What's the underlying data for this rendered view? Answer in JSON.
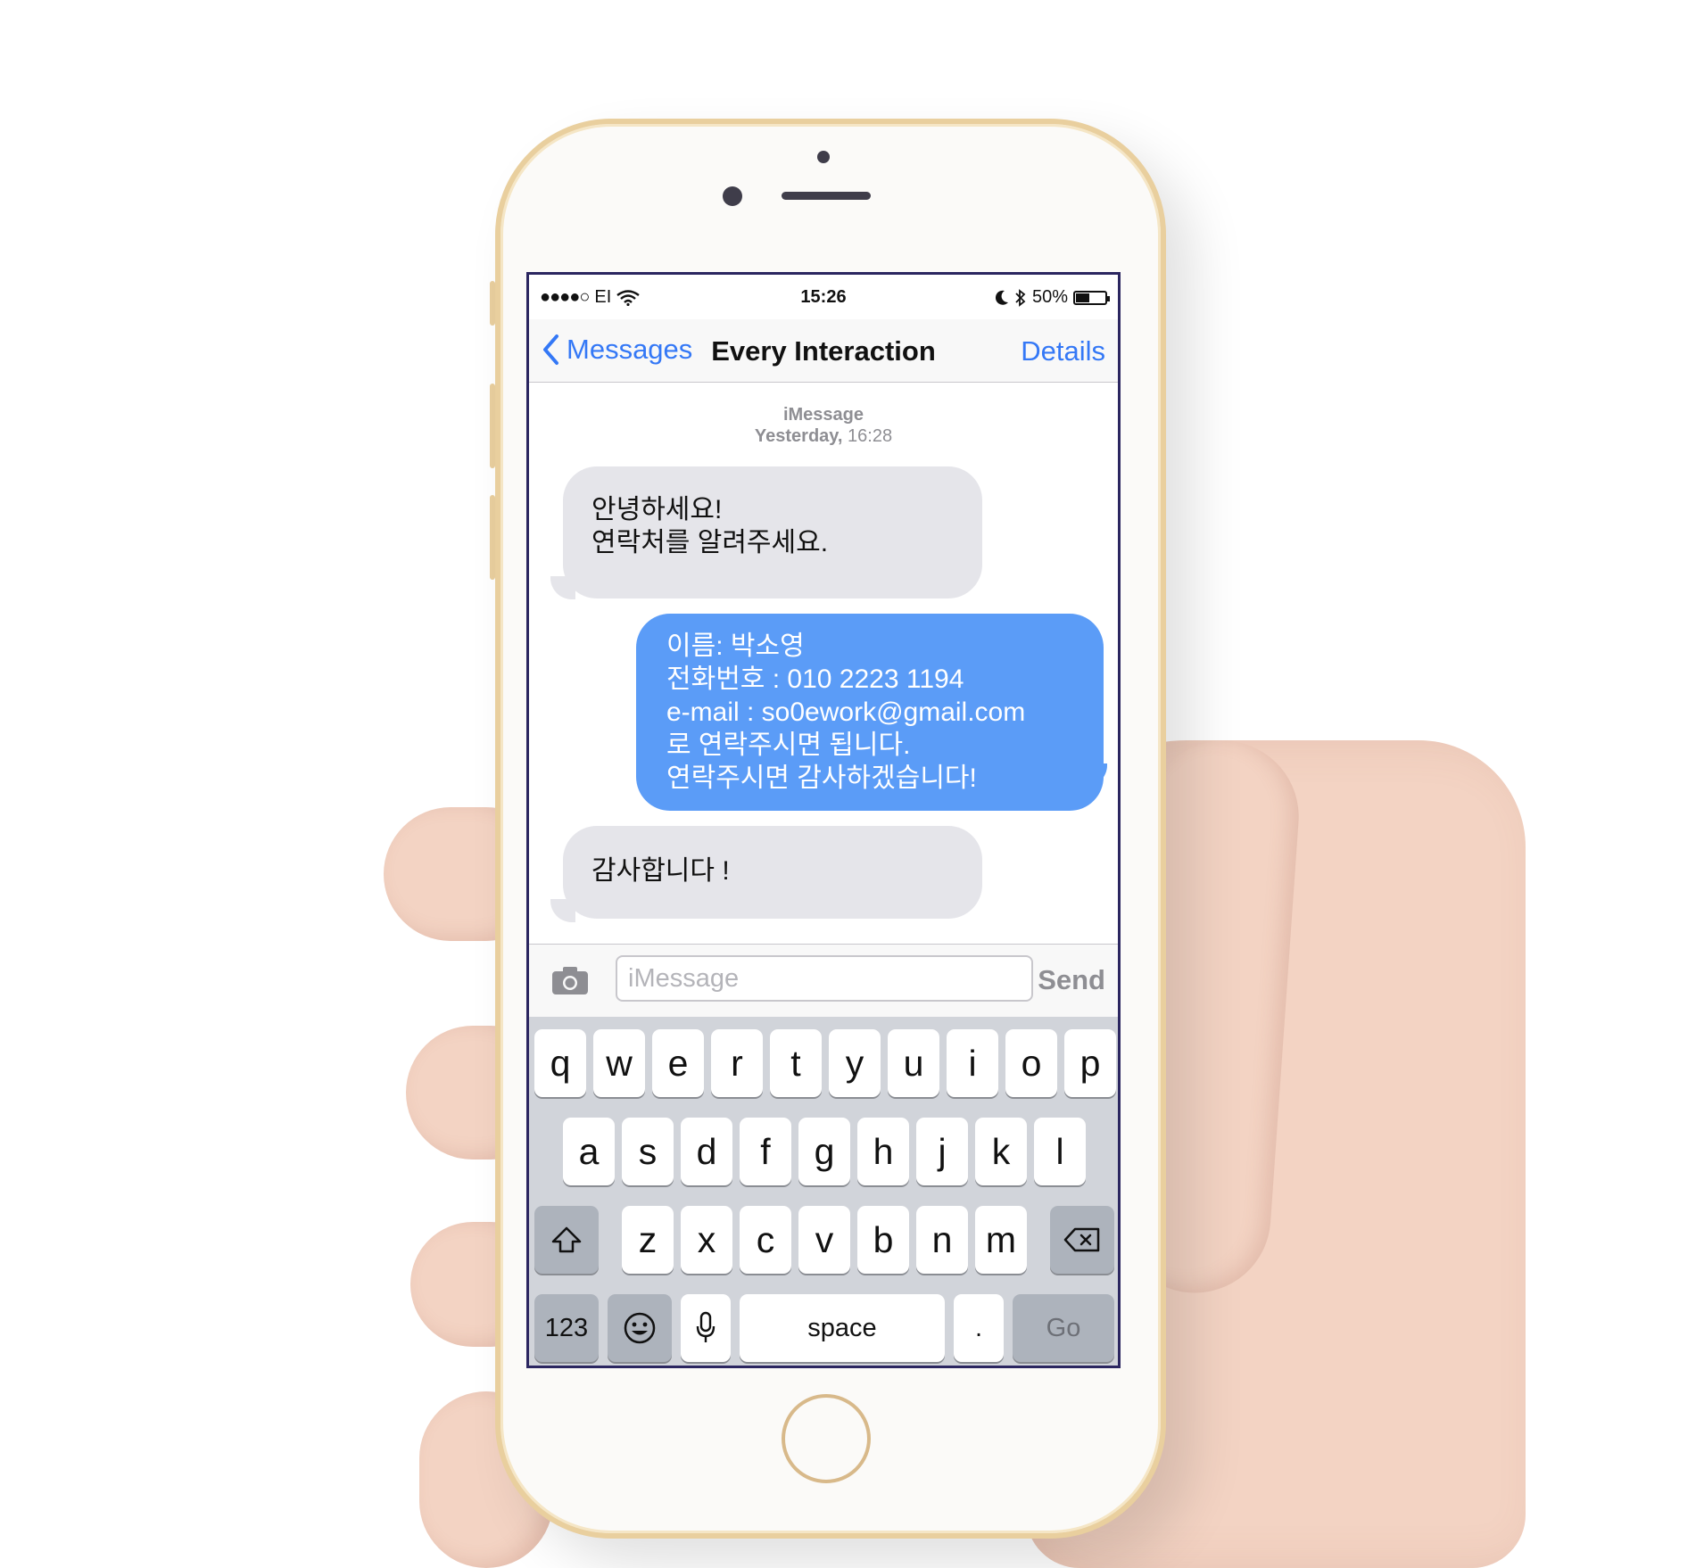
{
  "status_bar": {
    "signal": "●●●●○",
    "carrier": "EI",
    "time": "15:26",
    "battery_percent_label": "50%",
    "battery_level": 0.5
  },
  "nav": {
    "back_label": "Messages",
    "title": "Every Interaction",
    "details_label": "Details"
  },
  "thread": {
    "service": "iMessage",
    "day": "Yesterday,",
    "time": "16:28"
  },
  "messages": [
    {
      "direction": "incoming",
      "lines": [
        "안녕하세요!",
        "연락처를 알려주세요."
      ]
    },
    {
      "direction": "outgoing",
      "lines": [
        "이름: 박소영",
        "전화번호 : 010 2223 1194",
        "e-mail : so0ework@gmail.com",
        "로 연락주시면 됩니다.",
        "연락주시면 감사하겠습니다!"
      ]
    },
    {
      "direction": "incoming",
      "lines": [
        "감사합니다 !"
      ]
    }
  ],
  "composer": {
    "placeholder": "iMessage",
    "send_label": "Send",
    "camera_icon": "camera-icon"
  },
  "keyboard": {
    "row1": [
      "q",
      "w",
      "e",
      "r",
      "t",
      "y",
      "u",
      "i",
      "o",
      "p"
    ],
    "row2": [
      "a",
      "s",
      "d",
      "f",
      "g",
      "h",
      "j",
      "k",
      "l"
    ],
    "row3": [
      "z",
      "x",
      "c",
      "v",
      "b",
      "n",
      "m"
    ],
    "shift_icon": "shift-icon",
    "delete_icon": "delete-icon",
    "numbers_label": "123",
    "emoji_icon": "emoji-icon",
    "mic_icon": "microphone-icon",
    "space_label": "space",
    "period_label": ".",
    "go_label": "Go"
  },
  "colors": {
    "accent": "#3478f6",
    "outgoing_bubble": "#5b9cf7",
    "incoming_bubble": "#e5e5ea",
    "phone_frame": "#e9cf9e"
  }
}
